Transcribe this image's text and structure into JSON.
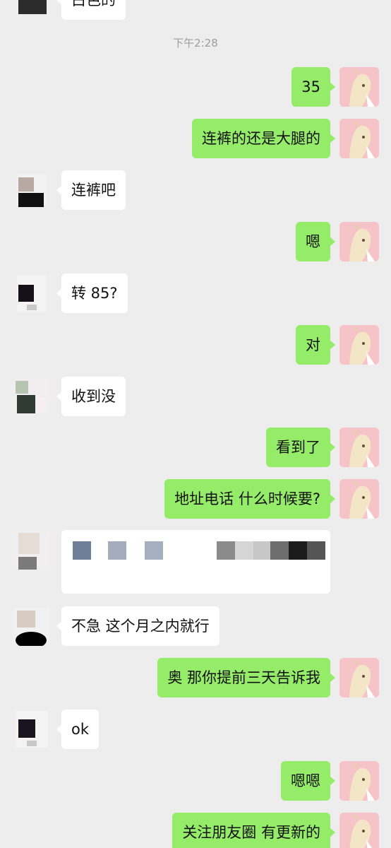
{
  "timestamp": "下午2:28",
  "top_partial_text": "白色的",
  "messages": [
    {
      "side": "me",
      "text": "35"
    },
    {
      "side": "me",
      "text": "连裤的还是大腿的"
    },
    {
      "side": "other",
      "text": "连裤吧"
    },
    {
      "side": "me",
      "text": "嗯"
    },
    {
      "side": "other",
      "text": "转 85?"
    },
    {
      "side": "me",
      "text": "对"
    },
    {
      "side": "other",
      "text": "收到没"
    },
    {
      "side": "me",
      "text": "看到了"
    },
    {
      "side": "me",
      "text": "地址电话  什么时候要?"
    },
    {
      "side": "other",
      "text": "[pixelated content]"
    },
    {
      "side": "other",
      "text": "不急 这个月之内就行"
    },
    {
      "side": "me",
      "text": "奥  那你提前三天告诉我"
    },
    {
      "side": "other",
      "text": "ok"
    },
    {
      "side": "me",
      "text": "嗯嗯"
    },
    {
      "side": "me",
      "text": "关注朋友圈 有更新的"
    }
  ],
  "colors": {
    "background": "#ededed",
    "my_bubble": "#95ec69",
    "other_bubble": "#ffffff",
    "timestamp_text": "#9d9d9d"
  },
  "icons": {
    "my_avatar": "anime-avatar-icon",
    "other_avatar": "pixelated-avatar-icon"
  }
}
